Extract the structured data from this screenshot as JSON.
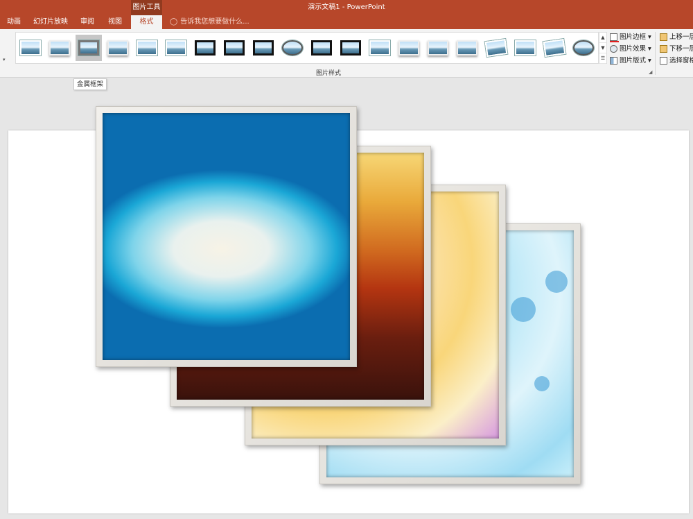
{
  "window": {
    "title": "演示文稿1 - PowerPoint"
  },
  "contextual_tab": {
    "header": "图片工具"
  },
  "tabs": [
    {
      "label": "动画"
    },
    {
      "label": "幻灯片放映"
    },
    {
      "label": "审阅"
    },
    {
      "label": "视图"
    },
    {
      "label": "格式",
      "active": true
    }
  ],
  "tell_me": {
    "placeholder": "告诉我您想要做什么..."
  },
  "ribbon": {
    "picture_styles": {
      "group_label": "图片样式",
      "selected_index": 2,
      "tooltip": "金属框架"
    },
    "commands": {
      "picture_border": "图片边框",
      "picture_effects": "图片效果",
      "picture_layout": "图片版式"
    },
    "arrange": {
      "bring_forward": "上移一层",
      "send_backward": "下移一层",
      "selection_pane": "选择窗格"
    }
  },
  "colors": {
    "accent": "#b7472a",
    "contextual": "#913a1f",
    "ribbon_bg": "#f3f3f3"
  }
}
